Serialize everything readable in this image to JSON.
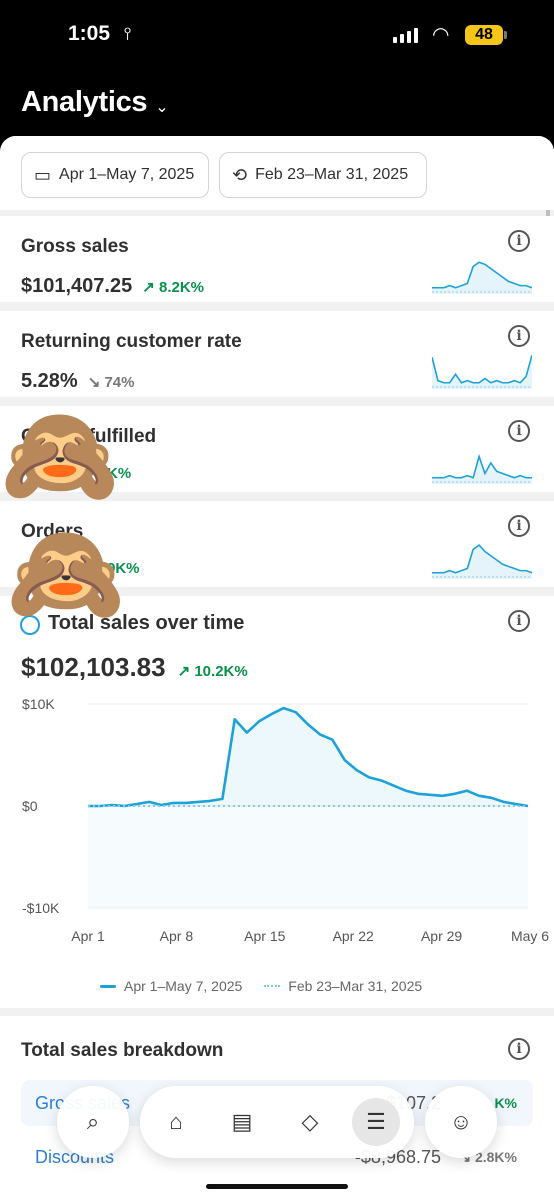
{
  "status_bar": {
    "time": "1:05",
    "battery": "48"
  },
  "header": {
    "title": "Analytics"
  },
  "date_filters": [
    {
      "label": "Apr 1–May 7, 2025",
      "icon": "calendar-icon"
    },
    {
      "label": "Feb 23–Mar 31, 2025",
      "icon": "calendar-compare-icon"
    }
  ],
  "metrics": [
    {
      "title": "Gross sales",
      "value": "$101,407.25",
      "change": "8.2K%",
      "direction": "up",
      "spark": [
        2,
        2,
        2,
        3,
        2,
        3,
        4,
        12,
        14,
        13,
        11,
        9,
        7,
        5,
        4,
        3,
        3,
        2
      ]
    },
    {
      "title": "Returning customer rate",
      "value": "5.28%",
      "change": "74%",
      "direction": "down",
      "spark": [
        14,
        3,
        2,
        2,
        6,
        2,
        3,
        2,
        2,
        4,
        2,
        3,
        2,
        2,
        3,
        2,
        5,
        15
      ]
    },
    {
      "title": "Orders fulfilled",
      "value": "",
      "change": "K%",
      "direction": "up",
      "spark": [
        2,
        2,
        2,
        3,
        2,
        2,
        3,
        2,
        12,
        4,
        9,
        5,
        4,
        3,
        2,
        3,
        2,
        2
      ]
    },
    {
      "title": "Orders",
      "value": "",
      "change": "9K%",
      "direction": "up",
      "spark": [
        2,
        2,
        2,
        3,
        2,
        3,
        4,
        13,
        15,
        12,
        10,
        8,
        6,
        5,
        4,
        3,
        3,
        2
      ]
    }
  ],
  "chart_card": {
    "title": "Total sales over time",
    "value": "$102,103.83",
    "change": "10.2K%",
    "legend": [
      "Apr 1–May 7, 2025",
      "Feb 23–Mar 31, 2025"
    ]
  },
  "chart_data": {
    "type": "line",
    "x_ticks": [
      "Apr 1",
      "Apr 8",
      "Apr 15",
      "Apr 22",
      "Apr 29",
      "May 6"
    ],
    "y_ticks": [
      "$10K",
      "$0",
      "-$10K"
    ],
    "ylim": [
      -10000,
      10000
    ],
    "grid": true,
    "legend_placement": "bottom",
    "series": [
      {
        "name": "Apr 1–May 7, 2025",
        "style": "solid",
        "values": [
          0,
          0,
          100,
          0,
          200,
          400,
          100,
          300,
          300,
          400,
          500,
          700,
          8500,
          7200,
          8300,
          9000,
          9600,
          9200,
          8000,
          7000,
          6500,
          4500,
          3500,
          2800,
          2500,
          2000,
          1500,
          1200,
          1100,
          1000,
          1200,
          1500,
          1000,
          800,
          400,
          200,
          0
        ]
      },
      {
        "name": "Feb 23–Mar 31, 2025",
        "style": "dotted",
        "values": [
          0,
          0,
          0,
          0,
          0,
          0,
          0,
          0,
          0,
          0,
          0,
          0,
          0,
          0,
          0,
          0,
          0,
          0,
          0,
          0,
          0,
          0,
          0,
          0,
          0,
          0,
          0,
          0,
          0,
          0,
          0,
          0,
          0,
          0,
          0,
          0,
          0
        ]
      }
    ]
  },
  "breakdown": {
    "title": "Total sales breakdown",
    "rows": [
      {
        "label": "Gross sales",
        "amount": "$107,2",
        "change": "K%"
      },
      {
        "label": "Discounts",
        "amount": "-$8,968.75",
        "change": "2.8K%"
      }
    ]
  },
  "nav": {
    "items": [
      "search-icon",
      "home-icon",
      "inbox-icon",
      "tag-icon",
      "menu-icon",
      "avatar-icon"
    ]
  },
  "colors": {
    "accent": "#1da1d8",
    "positive": "#0a8f4d"
  }
}
